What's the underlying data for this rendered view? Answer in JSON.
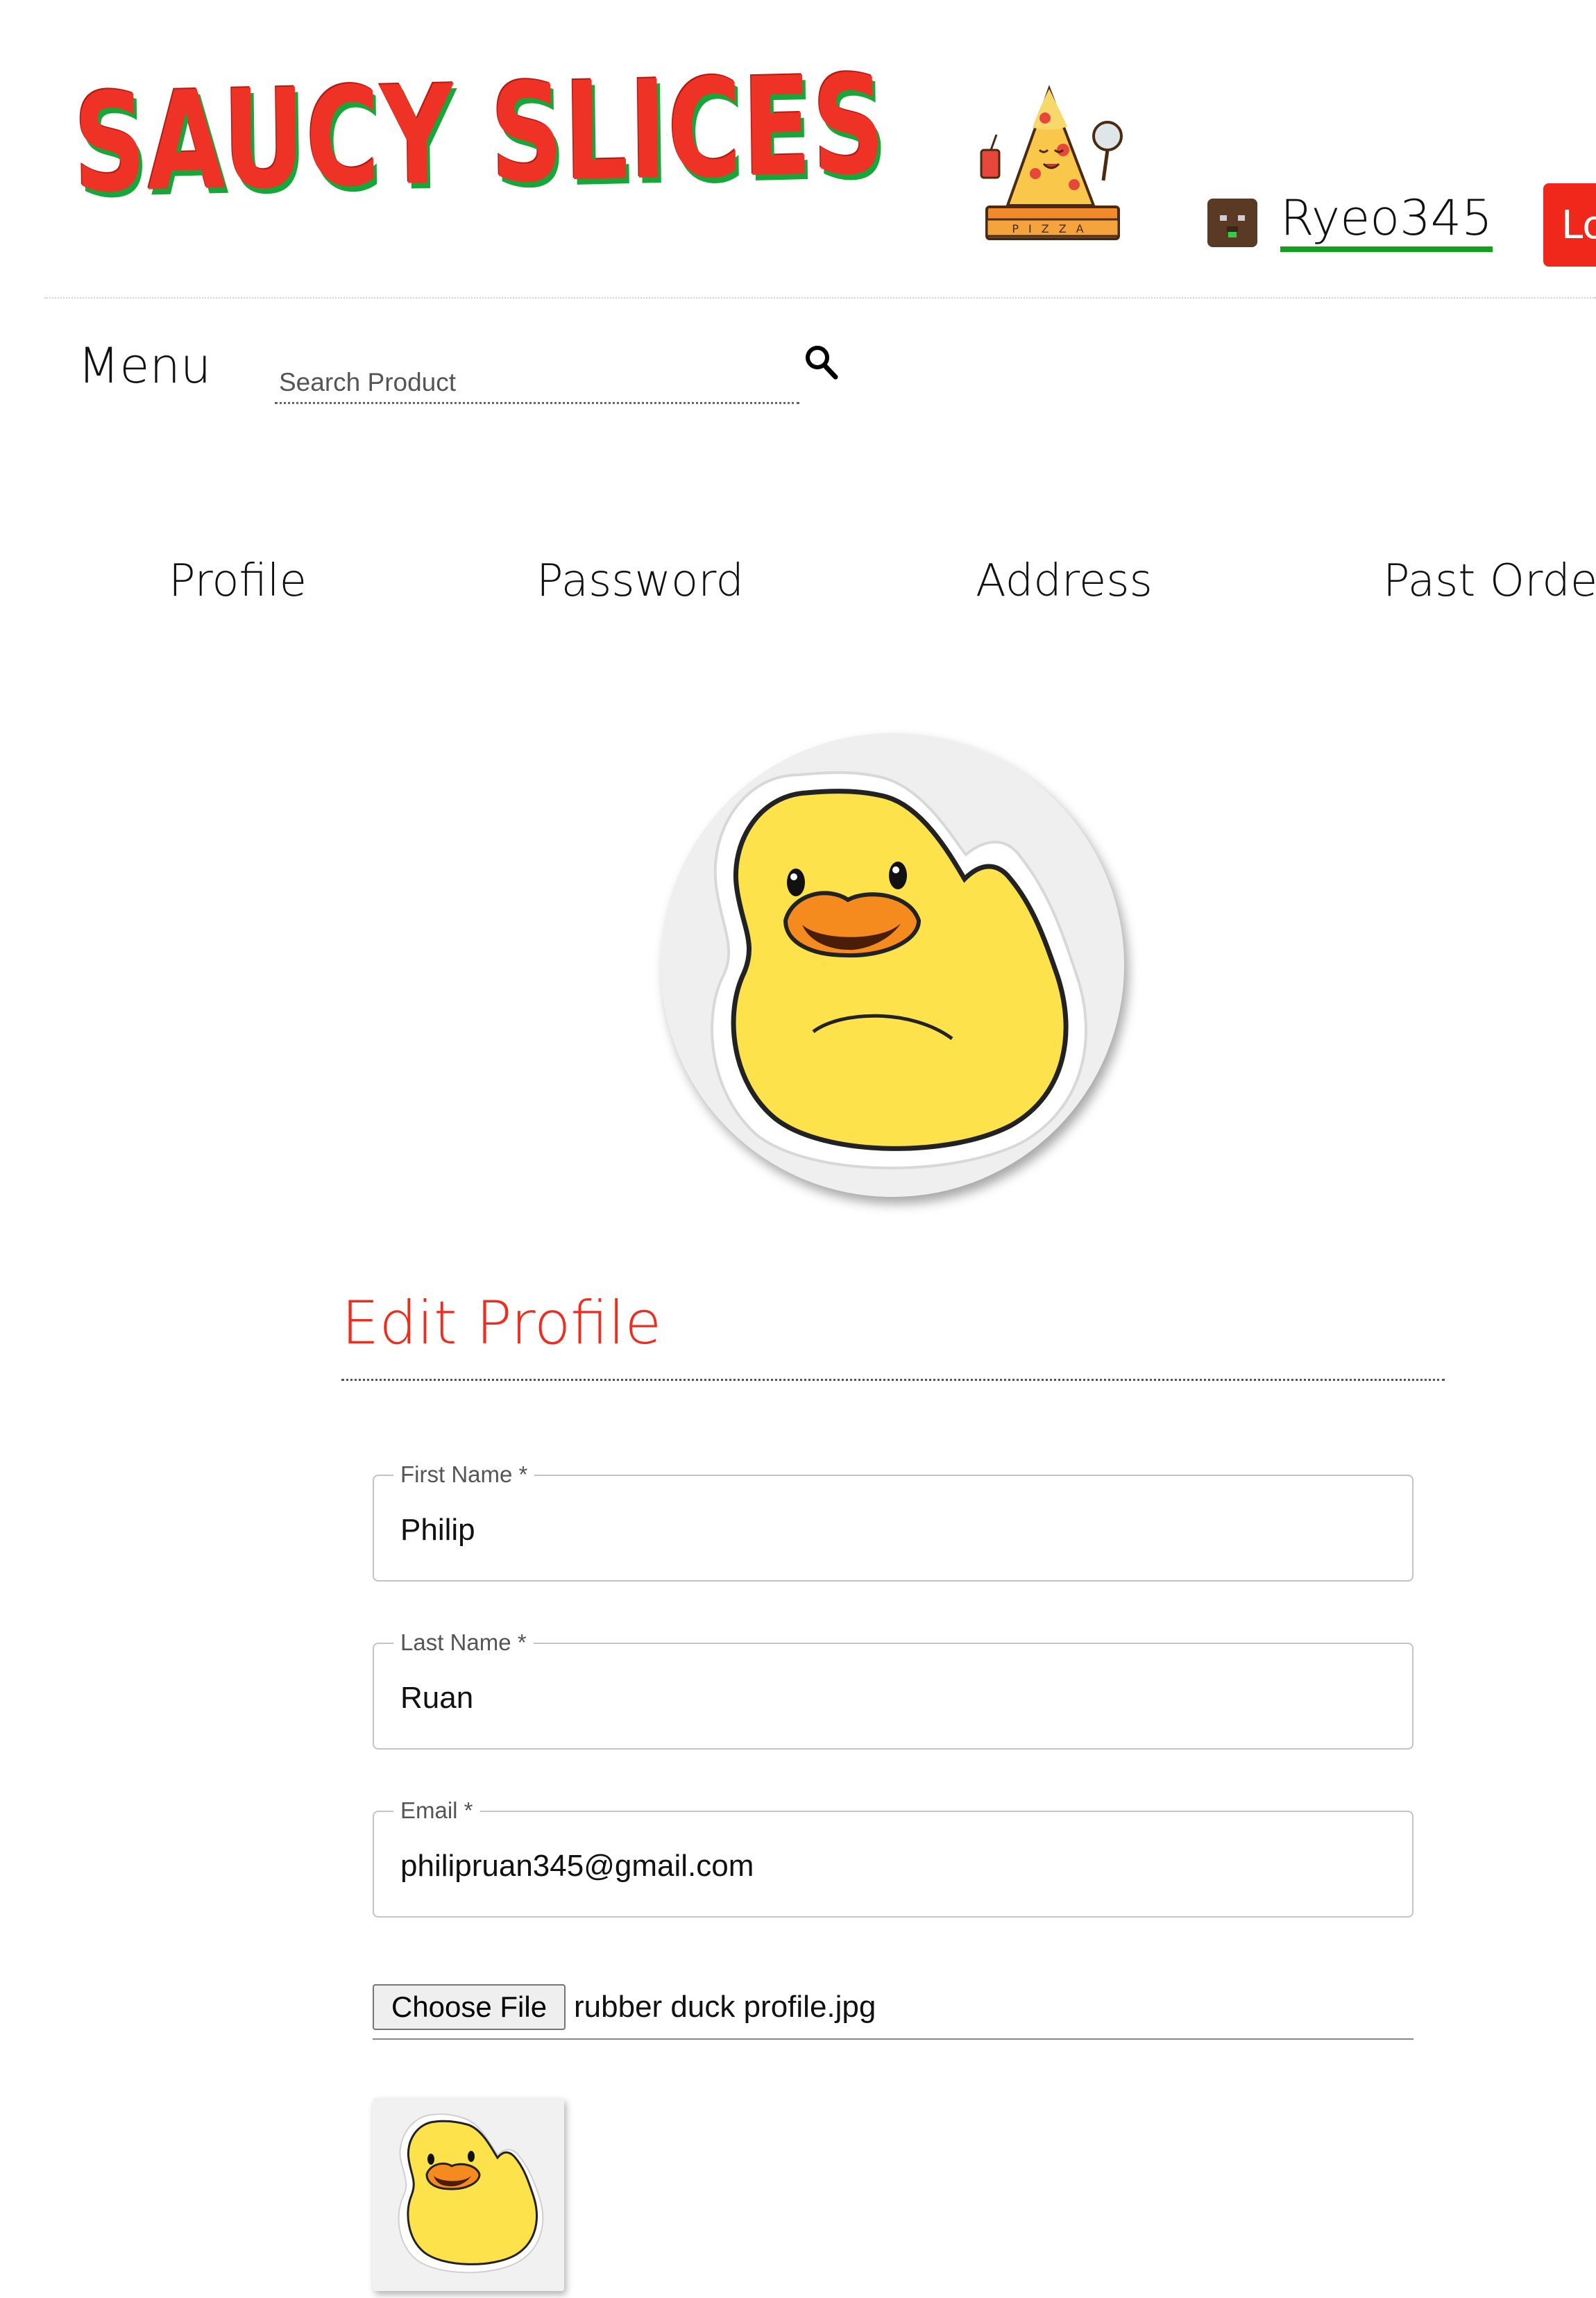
{
  "header": {
    "logo_text": "SAUCY SLICES",
    "mascot_icon": "pizza-mascot-icon",
    "user": {
      "avatar_icon": "user-avatar-icon",
      "username": "Ryeo345"
    },
    "login_label": "Lo"
  },
  "nav": {
    "menu_label": "Menu",
    "search": {
      "placeholder": "Search Product",
      "icon": "search-icon"
    }
  },
  "tabs": [
    {
      "label": "Profile"
    },
    {
      "label": "Password"
    },
    {
      "label": "Address"
    },
    {
      "label": "Past Order"
    }
  ],
  "profile": {
    "avatar_icon": "rubber-duck-icon"
  },
  "form": {
    "title": "Edit Profile",
    "fields": [
      {
        "label": "First Name *",
        "value": "Philip"
      },
      {
        "label": "Last Name *",
        "value": "Ruan"
      },
      {
        "label": "Email *",
        "value": "philipruan345@gmail.com"
      }
    ],
    "file": {
      "button_label": "Choose File",
      "file_name": "rubber duck profile.jpg"
    },
    "preview_icon": "rubber-duck-icon"
  },
  "colors": {
    "brand_red": "#ef3226",
    "brand_green": "#17a63a",
    "underline_green": "#14a01e",
    "duck_yellow": "#fde24c",
    "beak_orange": "#f58a1f"
  }
}
